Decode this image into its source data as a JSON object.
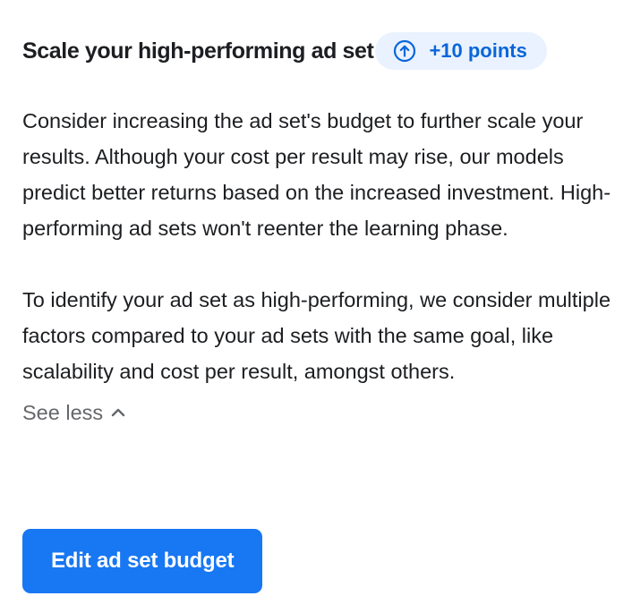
{
  "recommendation": {
    "title": "Scale your high-performing ad set",
    "badge": {
      "icon": "arrow-up-circle-icon",
      "label": "+10 points",
      "color": "#0a66d8",
      "background": "#e9f2fe"
    },
    "paragraphs": [
      "Consider increasing the ad set's budget to further scale your results. Although your cost per result may rise, our models predict better returns based on the increased investment. High-performing ad sets won't reenter the learning phase.",
      "To identify your ad set as high-performing, we consider multiple factors compared to your ad sets with the same goal, like scalability and cost per result, amongst others."
    ],
    "toggle": {
      "label": "See less",
      "icon": "chevron-up-icon"
    },
    "action": {
      "label": "Edit ad set budget",
      "color": "#1877f2"
    }
  }
}
